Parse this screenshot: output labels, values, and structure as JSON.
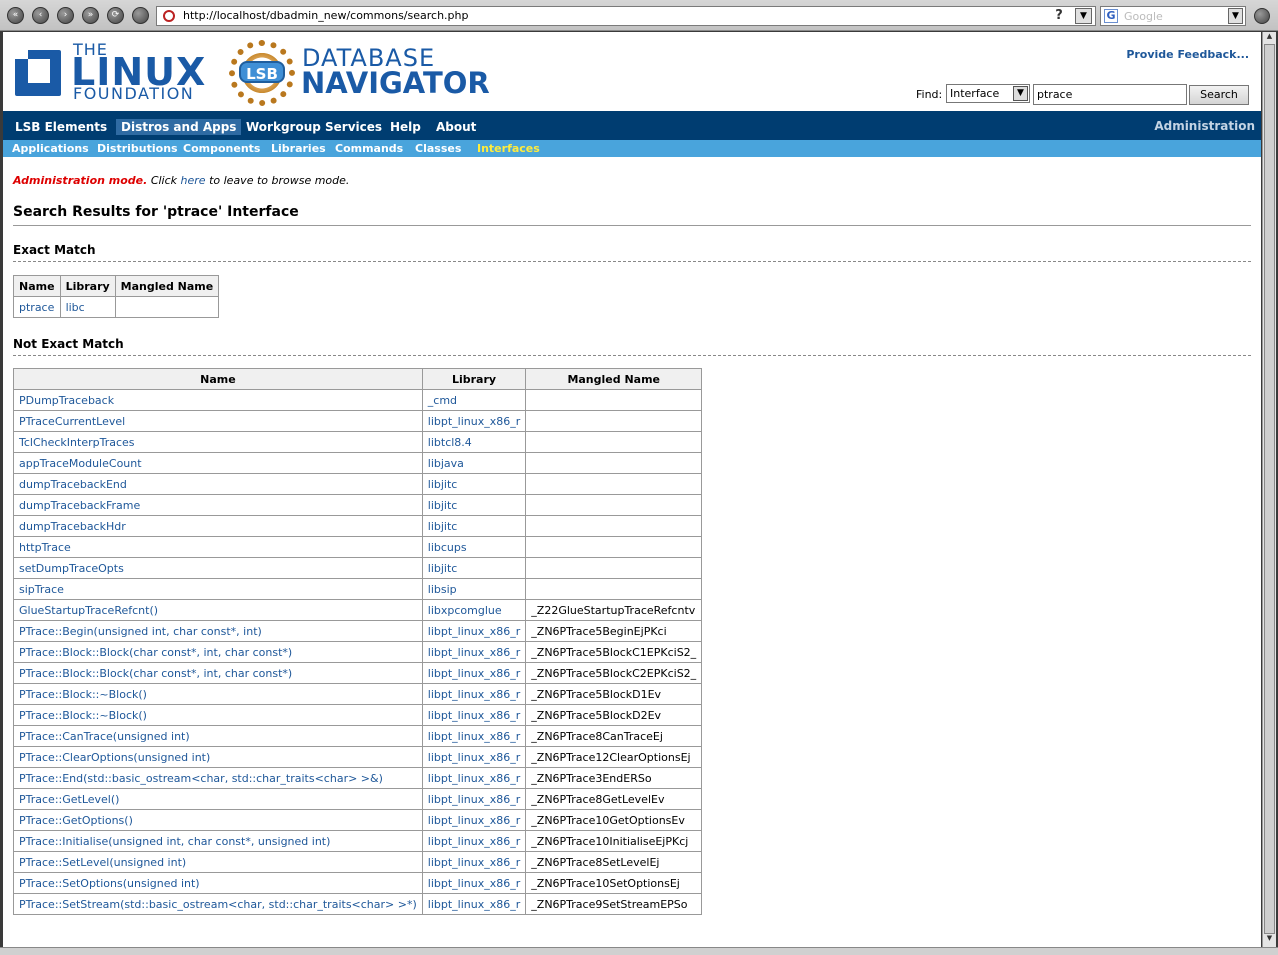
{
  "browser": {
    "url": "http://localhost/dbadmin_new/commons/search.php",
    "search_placeholder": "Google"
  },
  "header": {
    "lf_logo": {
      "the": "THE",
      "linux": "LINUX",
      "foundation": "FOUNDATION"
    },
    "dn_logo": {
      "badge": "LSB",
      "database": "DATABASE",
      "navigator": "NAVIGATOR"
    },
    "feedback": "Provide Feedback...",
    "find_label": "Find:",
    "find_type": "Interface",
    "find_value": "ptrace",
    "search_button": "Search"
  },
  "main_menu": {
    "items": [
      "LSB Elements",
      "Distros and Apps",
      "Workgroup Services",
      "Help",
      "About"
    ],
    "active": "Distros and Apps",
    "admin": "Administration"
  },
  "sub_menu": {
    "items": [
      "Applications",
      "Distributions",
      "Components",
      "Libraries",
      "Commands",
      "Classes",
      "Interfaces"
    ],
    "active": "Interfaces"
  },
  "admin_notice": {
    "mode": "Administration mode.",
    "before": " Click ",
    "link": "here",
    "after": " to leave to browse mode."
  },
  "page_title": "Search Results for 'ptrace' Interface",
  "exact": {
    "heading": "Exact Match",
    "columns": [
      "Name",
      "Library",
      "Mangled Name"
    ],
    "rows": [
      [
        "ptrace",
        "libc",
        ""
      ]
    ]
  },
  "not_exact": {
    "heading": "Not Exact Match",
    "columns": [
      "Name",
      "Library",
      "Mangled Name"
    ],
    "rows": [
      [
        "PDumpTraceback",
        "_cmd",
        ""
      ],
      [
        "PTraceCurrentLevel",
        "libpt_linux_x86_r",
        ""
      ],
      [
        "TclCheckInterpTraces",
        "libtcl8.4",
        ""
      ],
      [
        "appTraceModuleCount",
        "libjava",
        ""
      ],
      [
        "dumpTracebackEnd",
        "libjitc",
        ""
      ],
      [
        "dumpTracebackFrame",
        "libjitc",
        ""
      ],
      [
        "dumpTracebackHdr",
        "libjitc",
        ""
      ],
      [
        "httpTrace",
        "libcups",
        ""
      ],
      [
        "setDumpTraceOpts",
        "libjitc",
        ""
      ],
      [
        "sipTrace",
        "libsip",
        ""
      ],
      [
        "GlueStartupTraceRefcnt()",
        "libxpcomglue",
        "_Z22GlueStartupTraceRefcntv"
      ],
      [
        "PTrace::Begin(unsigned int, char const*, int)",
        "libpt_linux_x86_r",
        "_ZN6PTrace5BeginEjPKci"
      ],
      [
        "PTrace::Block::Block(char const*, int, char const*)",
        "libpt_linux_x86_r",
        "_ZN6PTrace5BlockC1EPKciS2_"
      ],
      [
        "PTrace::Block::Block(char const*, int, char const*)",
        "libpt_linux_x86_r",
        "_ZN6PTrace5BlockC2EPKciS2_"
      ],
      [
        "PTrace::Block::~Block()",
        "libpt_linux_x86_r",
        "_ZN6PTrace5BlockD1Ev"
      ],
      [
        "PTrace::Block::~Block()",
        "libpt_linux_x86_r",
        "_ZN6PTrace5BlockD2Ev"
      ],
      [
        "PTrace::CanTrace(unsigned int)",
        "libpt_linux_x86_r",
        "_ZN6PTrace8CanTraceEj"
      ],
      [
        "PTrace::ClearOptions(unsigned int)",
        "libpt_linux_x86_r",
        "_ZN6PTrace12ClearOptionsEj"
      ],
      [
        "PTrace::End(std::basic_ostream<char, std::char_traits<char> >&)",
        "libpt_linux_x86_r",
        "_ZN6PTrace3EndERSo"
      ],
      [
        "PTrace::GetLevel()",
        "libpt_linux_x86_r",
        "_ZN6PTrace8GetLevelEv"
      ],
      [
        "PTrace::GetOptions()",
        "libpt_linux_x86_r",
        "_ZN6PTrace10GetOptionsEv"
      ],
      [
        "PTrace::Initialise(unsigned int, char const*, unsigned int)",
        "libpt_linux_x86_r",
        "_ZN6PTrace10InitialiseEjPKcj"
      ],
      [
        "PTrace::SetLevel(unsigned int)",
        "libpt_linux_x86_r",
        "_ZN6PTrace8SetLevelEj"
      ],
      [
        "PTrace::SetOptions(unsigned int)",
        "libpt_linux_x86_r",
        "_ZN6PTrace10SetOptionsEj"
      ],
      [
        "PTrace::SetStream(std::basic_ostream<char, std::char_traits<char> >*)",
        "libpt_linux_x86_r",
        "_ZN6PTrace9SetStreamEPSo"
      ]
    ]
  }
}
